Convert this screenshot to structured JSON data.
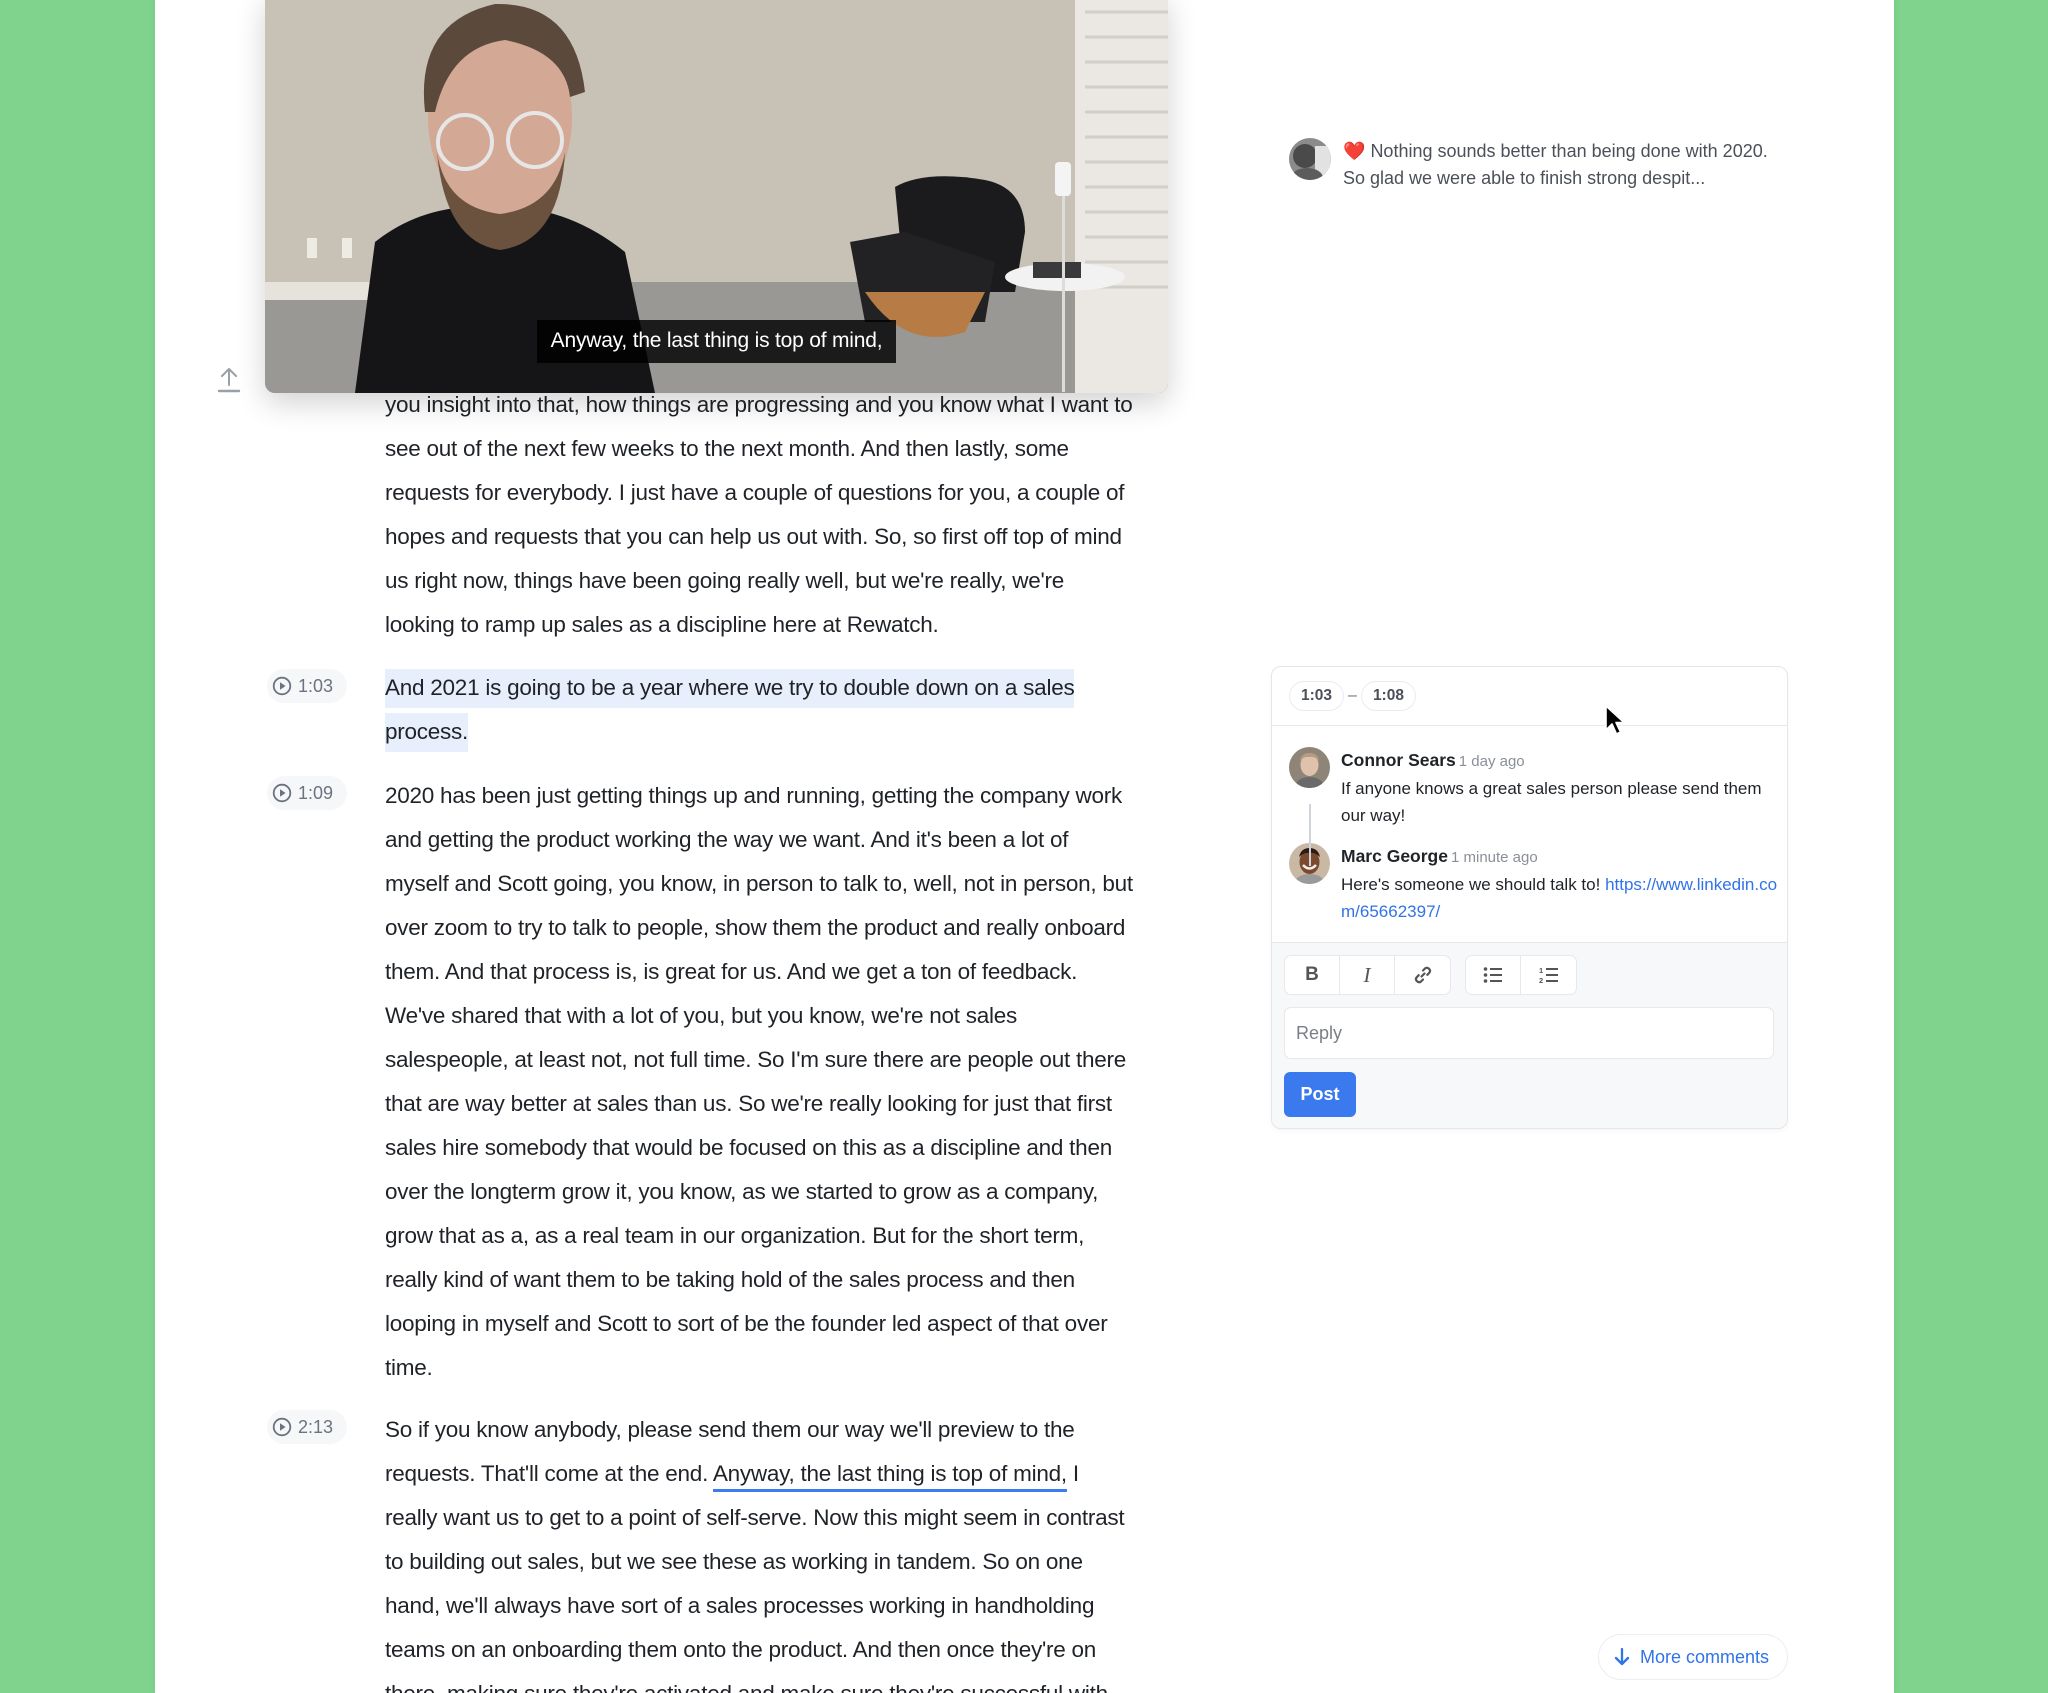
{
  "video": {
    "subtitle": "Anyway, the last thing is top of mind,"
  },
  "transcript": {
    "segments": [
      {
        "timestamp": "",
        "lines": [
          "you insight into that, how things are progressing and you know what I want to",
          "see out of the next few weeks to the next month. And then lastly, some",
          "requests for everybody. I just have a couple of questions for you, a couple of",
          "hopes and requests that you can help us out with. So, so first off top of mind",
          "us right now, things have been going really well, but we're really, we're",
          "looking to ramp up sales as a discipline here at Rewatch."
        ]
      },
      {
        "timestamp": "1:03",
        "highlighted": true,
        "lines": [
          "And 2021 is going to be a year where we try to double down on a sales",
          "process."
        ]
      },
      {
        "timestamp": "1:09",
        "lines": [
          "2020 has been just getting things up and running, getting the company work",
          "and getting the product working the way we want. And it's been a lot of",
          "myself and Scott going, you know, in person to talk to, well, not in person, but",
          "over zoom to try to talk to people, show them the product and really onboard",
          "them. And that process is, is great for us. And we get a ton of feedback.",
          "We've shared that with a lot of you, but you know, we're not sales",
          "salespeople, at least not, not full time. So I'm sure there are people out there",
          "that are way better at sales than us. So we're really looking for just that first",
          "sales hire somebody that would be focused on this as a discipline and then",
          "over the longterm grow it, you know, as we started to grow as a company,",
          "grow that as a, as a real team in our organization. But for the short term,",
          "really kind of want them to be taking hold of the sales process and then",
          "looping in myself and Scott to sort of be the founder led aspect of that over",
          "time."
        ]
      },
      {
        "timestamp": "2:13",
        "line1": "So if you know anybody, please send them our way we'll preview to the",
        "line2_before": "requests. That'll come at the end. ",
        "line2_active": "Anyway, the last thing is top of mind,",
        "line2_after": " I",
        "lines_rest": [
          "really want us to get to a point of self-serve. Now this might seem in contrast",
          "to building out sales, but we see these as working in tandem. So on one",
          "hand, we'll always have sort of a sales processes working in handholding",
          "teams on an onboarding them onto the product. And then once they're on",
          "there, making sure they're activated and make sure they're successful with"
        ]
      }
    ]
  },
  "sidebar": {
    "preview_comment": {
      "emoji": "❤️",
      "text": "Nothing sounds better than being done with 2020. So glad we were able to finish strong despit..."
    },
    "thread": {
      "range_start": "1:03",
      "range_sep": "–",
      "range_end": "1:08",
      "comments": [
        {
          "author": "Connor Sears",
          "time": "1 day ago",
          "text": "If anyone knows a great sales person please send them our way!"
        },
        {
          "author": "Marc George",
          "time": "1 minute ago",
          "text": "Here's someone we should talk to! ",
          "link": "https://www.linkedin.com/65662397/"
        }
      ],
      "toolbar": {
        "bold": "B",
        "italic": "I"
      },
      "reply_placeholder": "Reply",
      "reply_value": "",
      "post_label": "Post"
    },
    "more_comments_label": "More comments"
  },
  "colors": {
    "background": "#7fd38c",
    "accent": "#3a79ee",
    "highlight": "#e8effc"
  }
}
